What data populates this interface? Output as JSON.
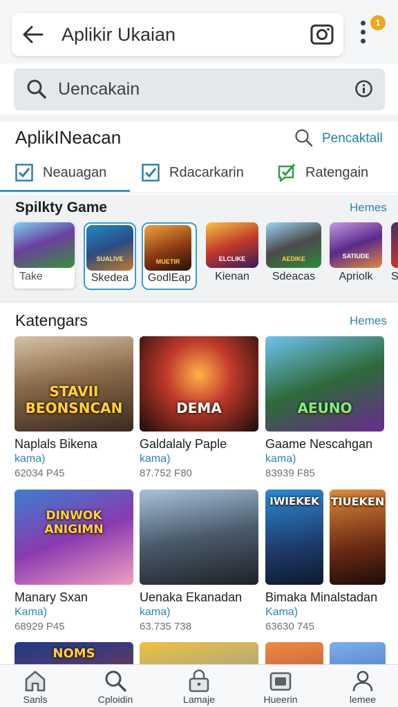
{
  "topbar": {
    "title": "Aplikir Ukaian",
    "notification_count": "1"
  },
  "search": {
    "placeholder": "Uencakain"
  },
  "apps_header": {
    "title": "AplikINeacan",
    "link": "Pencaktall"
  },
  "tabs": [
    {
      "label": "Neauagan"
    },
    {
      "label": "Rdacarkarin"
    },
    {
      "label": "Ratengain"
    }
  ],
  "games_section": {
    "title": "Spilkty Game",
    "link": "Hemes",
    "items": [
      {
        "label": "Take"
      },
      {
        "label": "Skedea",
        "art": "SUALIVE"
      },
      {
        "label": "GodlEap",
        "art": "MUETIR"
      },
      {
        "label": "Kienan",
        "art": "ELCLIKE"
      },
      {
        "label": "Sdeacas",
        "art": "AEDIKE"
      },
      {
        "label": "Apriolk",
        "art": "SATIUDE"
      },
      {
        "label": "S"
      }
    ]
  },
  "categories": {
    "title": "Katengars",
    "link": "Hemes",
    "tiles": [
      {
        "name": "Naplals Bikena",
        "sub": "kama)",
        "meta": "62034 P45",
        "art": "STAVII BEONSNCAN"
      },
      {
        "name": "Galdalaly Paple",
        "sub": "kama)",
        "meta": "87.752 F80",
        "art": "DEMA"
      },
      {
        "name": "Gaame Nescahgan",
        "sub": "kama)",
        "meta": "83939 F85",
        "art": "AEUNO"
      },
      {
        "name": "Manary Sxan",
        "sub": "Kama)",
        "meta": "68929 P45",
        "art": "DINWOK ANIGIMN"
      },
      {
        "name": "Uenaka Ekanadan",
        "sub": "kama)",
        "meta": "63.735 738",
        "art": ""
      },
      {
        "name": "Bimaka Minalstadan",
        "sub": "Kama)",
        "meta": "63630 745",
        "art": "IWIEKEK"
      },
      {
        "name": "",
        "sub": "",
        "meta": "",
        "art": "NOMS"
      }
    ],
    "extra_art": "TIUEKEN"
  },
  "bottom_nav": [
    {
      "label": "Sanls",
      "icon": "home-icon"
    },
    {
      "label": "Cploidin",
      "icon": "search-icon"
    },
    {
      "label": "Lamaje",
      "icon": "lock-icon"
    },
    {
      "label": "Hueerin",
      "icon": "photo-icon"
    },
    {
      "label": "lemee",
      "icon": "person-icon"
    }
  ],
  "colors": {
    "accent": "#2a86b0",
    "tab_underline": "#3294c7",
    "check_green": "#2ea043",
    "badge": "#f4a71d"
  }
}
